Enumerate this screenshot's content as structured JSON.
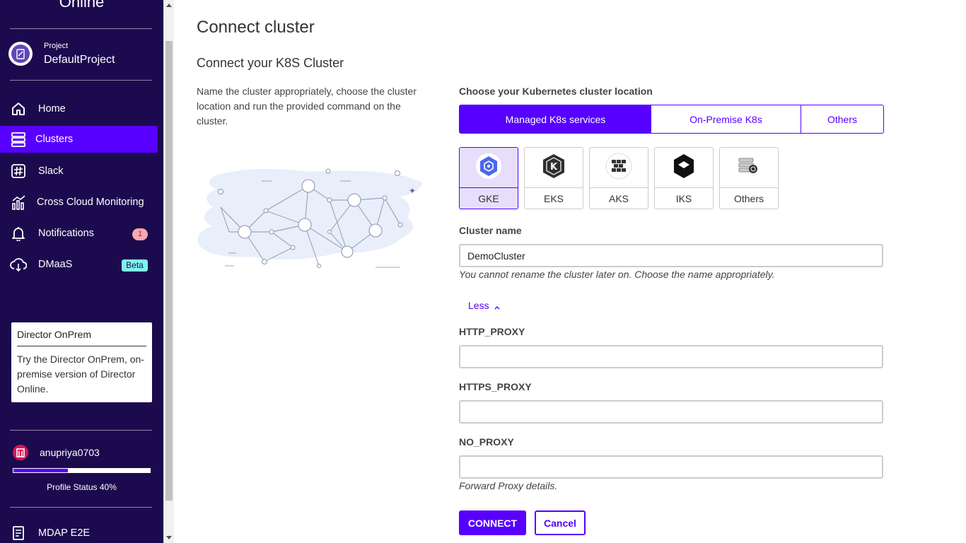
{
  "sidebar": {
    "brand_tail": "Online",
    "project": {
      "label": "Project",
      "name": "DefaultProject"
    },
    "items": [
      {
        "label": "Home",
        "icon": "home-icon"
      },
      {
        "label": "Clusters",
        "icon": "clusters-icon"
      },
      {
        "label": "Slack",
        "icon": "slack-icon"
      },
      {
        "label": "Cross Cloud Monitoring",
        "icon": "monitoring-icon"
      },
      {
        "label": "Notifications",
        "icon": "bell-icon",
        "badge": "1"
      },
      {
        "label": "DMaaS",
        "icon": "cloud-sync-icon",
        "badge": "Beta"
      },
      {
        "label": "MDAP E2E",
        "icon": "document-icon"
      }
    ],
    "promo": {
      "title": "Director OnPrem",
      "text": "Try the Director OnPrem, on-premise version of Director Online."
    },
    "user": {
      "name": "anupriya0703"
    },
    "profile": {
      "status": "Profile Status 40%",
      "progress_percent": 40
    }
  },
  "main": {
    "title": "Connect cluster",
    "subtitle": "Connect your K8S Cluster",
    "description": "Name the cluster appropriately, choose the cluster location and run the provided command on the cluster.",
    "location_label": "Choose your Kubernetes cluster location",
    "location_tabs": [
      "Managed K8s services",
      "On-Premise K8s",
      "Others"
    ],
    "providers": [
      "GKE",
      "EKS",
      "AKS",
      "IKS",
      "Others"
    ],
    "cluster_name": {
      "label": "Cluster name",
      "value": "DemoCluster",
      "hint": "You cannot rename the cluster later on. Choose the name appropriately."
    },
    "less_label": "Less",
    "http_proxy": {
      "label": "HTTP_PROXY",
      "value": ""
    },
    "https_proxy": {
      "label": "HTTPS_PROXY",
      "value": ""
    },
    "no_proxy": {
      "label": "NO_PROXY",
      "value": "",
      "hint": "Forward Proxy details."
    },
    "connect_label": "CONNECT",
    "cancel_label": "Cancel"
  },
  "colors": {
    "sidebar_bg": "#1c0a4f",
    "accent": "#5700ff",
    "beta_badge": "#7ff3ea",
    "count_badge": "#f7a9b0"
  }
}
